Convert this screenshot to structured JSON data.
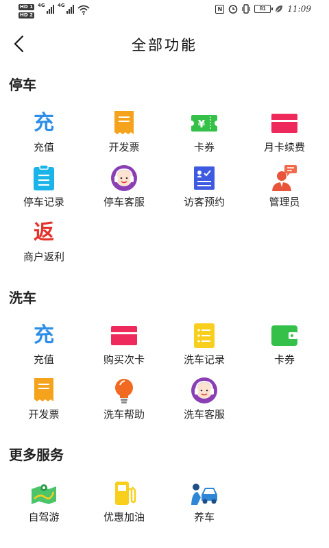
{
  "status_bar": {
    "sim1": "HD 1",
    "sim2": "HD 2",
    "net1": "4G",
    "net2": "4G",
    "nfc": "N",
    "battery": "81",
    "time": "11:09"
  },
  "nav": {
    "title": "全部功能"
  },
  "sections": {
    "parking": {
      "title": "停车",
      "items": [
        {
          "label": "充值",
          "glyph": "充"
        },
        {
          "label": "开发票"
        },
        {
          "label": "卡券",
          "glyph": "¥"
        },
        {
          "label": "月卡续费"
        },
        {
          "label": "停车记录"
        },
        {
          "label": "停车客服"
        },
        {
          "label": "访客预约"
        },
        {
          "label": "管理员"
        },
        {
          "label": "商户返利",
          "glyph": "返"
        }
      ]
    },
    "carwash": {
      "title": "洗车",
      "items": [
        {
          "label": "充值",
          "glyph": "充"
        },
        {
          "label": "购买次卡"
        },
        {
          "label": "洗车记录"
        },
        {
          "label": "卡券"
        },
        {
          "label": "开发票"
        },
        {
          "label": "洗车帮助"
        },
        {
          "label": "洗车客服"
        }
      ]
    },
    "more": {
      "title": "更多服务",
      "items": [
        {
          "label": "自驾游"
        },
        {
          "label": "优惠加油"
        },
        {
          "label": "养车"
        }
      ]
    }
  },
  "colors": {
    "blue": "#2f8fe8",
    "orange": "#f5a21c",
    "green": "#35c04a",
    "pink": "#ee2a5c",
    "cyan": "#1ab4e8",
    "purple": "#8a3fb5",
    "indigo": "#3d5ae0",
    "red": "#e4322b",
    "yellow": "#f7cf1c"
  }
}
